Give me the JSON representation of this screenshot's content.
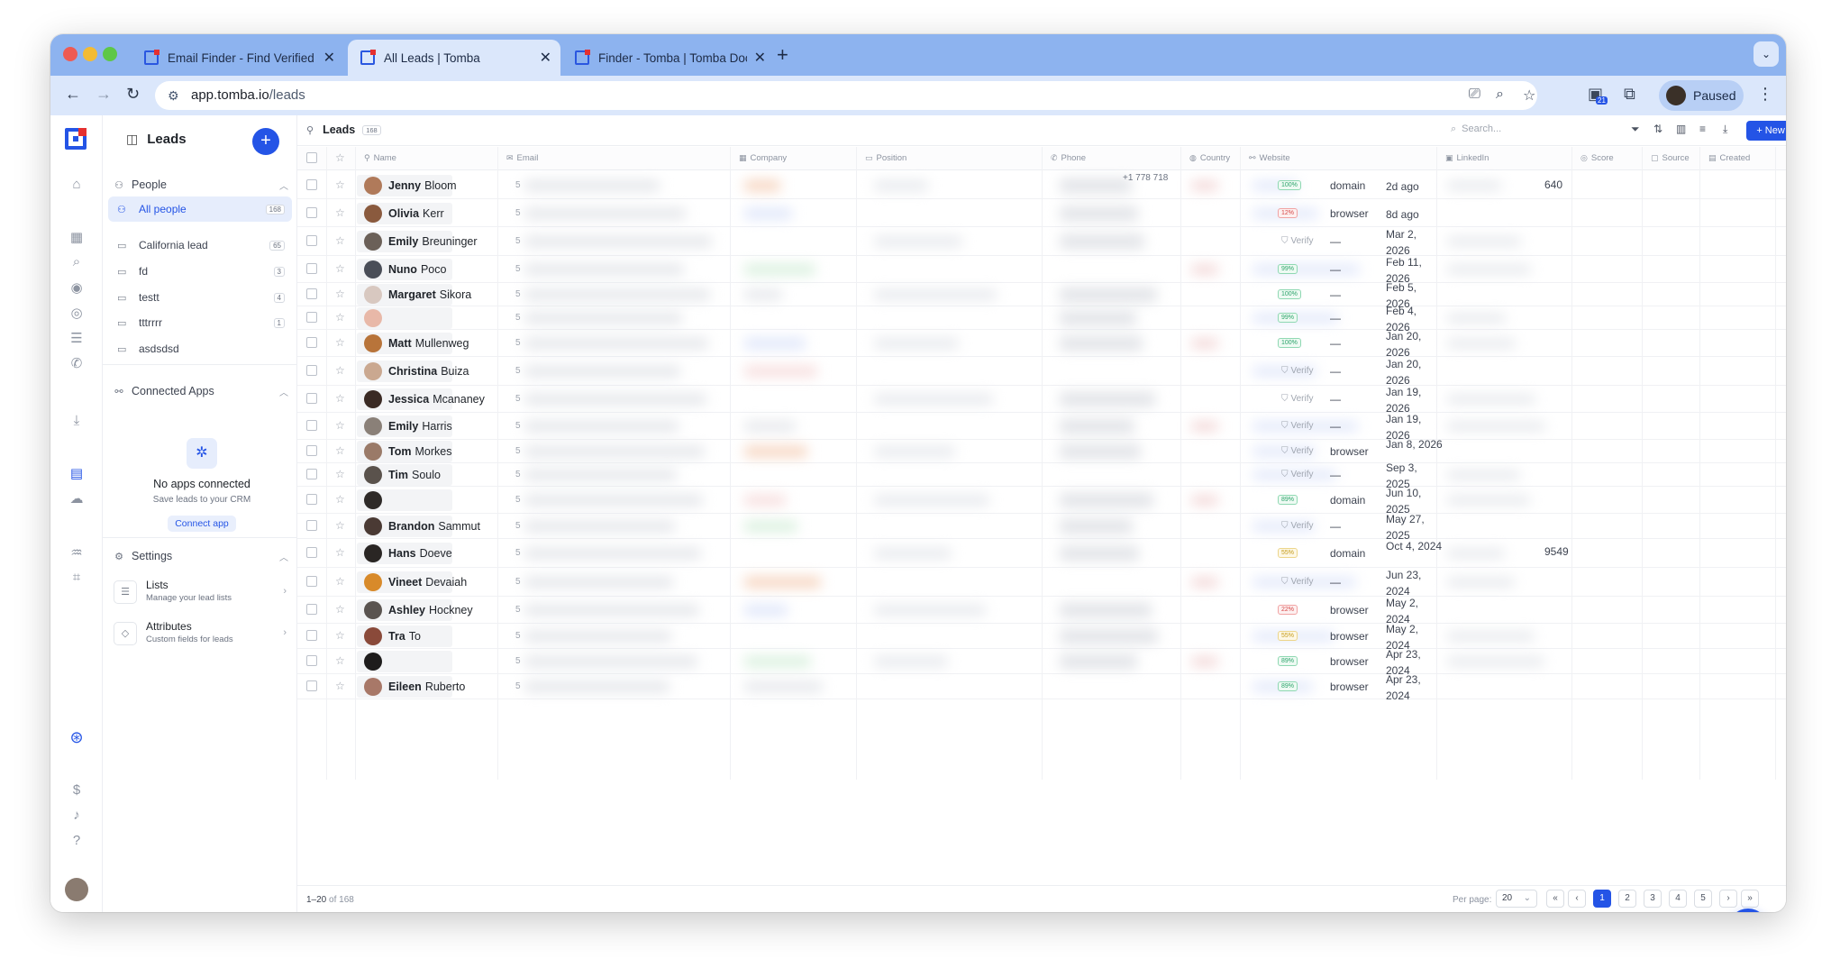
{
  "browser": {
    "tabs": [
      {
        "title": "Email Finder - Find Verified B",
        "active": false
      },
      {
        "title": "All Leads | Tomba",
        "active": true
      },
      {
        "title": "Finder - Tomba | Tomba Docu",
        "active": false
      }
    ],
    "url_host": "app.tomba.io",
    "url_path": "/leads",
    "profile_label": "Paused",
    "extension_badge": "21"
  },
  "sidebar": {
    "title": "Leads",
    "people_label": "People",
    "all_people": {
      "label": "All people",
      "count": "168"
    },
    "lists": [
      {
        "label": "California lead",
        "count": "65"
      },
      {
        "label": "fd",
        "count": "3"
      },
      {
        "label": "testt",
        "count": "4"
      },
      {
        "label": "tttrrrr",
        "count": "1"
      },
      {
        "label": "asdsdsd",
        "count": ""
      }
    ],
    "connected_apps_label": "Connected Apps",
    "no_apps_title": "No apps connected",
    "no_apps_sub": "Save leads to your CRM",
    "connect_app_label": "Connect app",
    "settings_label": "Settings",
    "settings_items": [
      {
        "title": "Lists",
        "subtitle": "Manage your lead lists"
      },
      {
        "title": "Attributes",
        "subtitle": "Custom fields for leads"
      }
    ]
  },
  "main": {
    "title": "Leads",
    "count": "168",
    "search_placeholder": "Search...",
    "new_lead_label": "+ New lead",
    "columns": [
      "Name",
      "Email",
      "Company",
      "Position",
      "Phone",
      "Country",
      "Website",
      "LinkedIn",
      "Score",
      "Source",
      "Created"
    ],
    "email_stub": "5",
    "leaked_text": {
      "row0_linkedin": "640",
      "row14_linkedin": "9549",
      "row0_phone": "+1 778 718"
    },
    "verify_label": "Verify",
    "dash": "—",
    "rows": [
      {
        "first": "Jenny",
        "last": "Bloom",
        "score": "100%",
        "score_color": "green",
        "source": "domain",
        "created": "2d ago",
        "avatar": "#b07a5a"
      },
      {
        "first": "Olivia",
        "last": "Kerr",
        "score": "12%",
        "score_color": "red",
        "source": "browser",
        "created": "8d ago",
        "avatar": "#8a5a3e"
      },
      {
        "first": "Emily",
        "last": "Breuninger",
        "score": "",
        "score_color": "",
        "source": "—",
        "created": "Mar 2, 2026",
        "avatar": "#6b6058"
      },
      {
        "first": "Nuno",
        "last": "Poco",
        "score": "99%",
        "score_color": "green",
        "source": "—",
        "created": "Feb 11, 2026",
        "avatar": "#4a4e58"
      },
      {
        "first": "Margaret",
        "last": "Sikora",
        "score": "100%",
        "score_color": "green",
        "source": "—",
        "created": "Feb 5, 2026",
        "avatar": "#d8c8c0"
      },
      {
        "first": "",
        "last": "",
        "score": "99%",
        "score_color": "green",
        "source": "—",
        "created": "Feb 4, 2026",
        "avatar": "#e8b8a8"
      },
      {
        "first": "Matt",
        "last": "Mullenweg",
        "score": "100%",
        "score_color": "green",
        "source": "—",
        "created": "Jan 20, 2026",
        "avatar": "#b8743a"
      },
      {
        "first": "Christina",
        "last": "Buiza",
        "score": "",
        "score_color": "",
        "source": "—",
        "created": "Jan 20, 2026",
        "avatar": "#caa890"
      },
      {
        "first": "Jessica",
        "last": "Mcananey",
        "score": "",
        "score_color": "",
        "source": "—",
        "created": "Jan 19, 2026",
        "avatar": "#3a2a24"
      },
      {
        "first": "Emily",
        "last": "Harris",
        "score": "",
        "score_color": "",
        "source": "—",
        "created": "Jan 19, 2026",
        "avatar": "#8a8078"
      },
      {
        "first": "Tom",
        "last": "Morkes",
        "score": "",
        "score_color": "",
        "source": "browser",
        "created": "Jan 8, 2026",
        "avatar": "#9a7a68"
      },
      {
        "first": "Tim",
        "last": "Soulo",
        "score": "",
        "score_color": "",
        "source": "—",
        "created": "Sep 3, 2025",
        "avatar": "#5a524c"
      },
      {
        "first": "",
        "last": "",
        "score": "89%",
        "score_color": "green",
        "source": "domain",
        "created": "Jun 10, 2025",
        "avatar": "#2e2a28"
      },
      {
        "first": "Brandon",
        "last": "Sammut",
        "score": "",
        "score_color": "",
        "source": "—",
        "created": "May 27, 2025",
        "avatar": "#4a3a34"
      },
      {
        "first": "Hans",
        "last": "Doeve",
        "score": "55%",
        "score_color": "yellow",
        "source": "domain",
        "created": "Oct 4, 2024",
        "avatar": "#2a2624"
      },
      {
        "first": "Vineet",
        "last": "Devaiah",
        "score": "",
        "score_color": "",
        "source": "—",
        "created": "Jun 23, 2024",
        "avatar": "#d88a2a"
      },
      {
        "first": "Ashley",
        "last": "Hockney",
        "score": "22%",
        "score_color": "red",
        "source": "browser",
        "created": "May 2, 2024",
        "avatar": "#5a5450"
      },
      {
        "first": "Tra",
        "last": "To",
        "score": "55%",
        "score_color": "yellow",
        "source": "browser",
        "created": "May 2, 2024",
        "avatar": "#8a4a3a"
      },
      {
        "first": "",
        "last": "",
        "score": "89%",
        "score_color": "green",
        "source": "browser",
        "created": "Apr 23, 2024",
        "avatar": "#1e1c1c"
      },
      {
        "first": "Eileen",
        "last": "Ruberto",
        "score": "89%",
        "score_color": "green",
        "source": "browser",
        "created": "Apr 23, 2024",
        "avatar": "#a87868"
      }
    ]
  },
  "footer": {
    "range": "1–20",
    "of_text": "of 168",
    "per_page_label": "Per page:",
    "per_page_value": "20",
    "pages": [
      "1",
      "2",
      "3",
      "4",
      "5"
    ]
  },
  "colors": {
    "accent": "#2454e6",
    "tab_strip": "#8db3ef",
    "toolbar": "#dbe7fb"
  }
}
